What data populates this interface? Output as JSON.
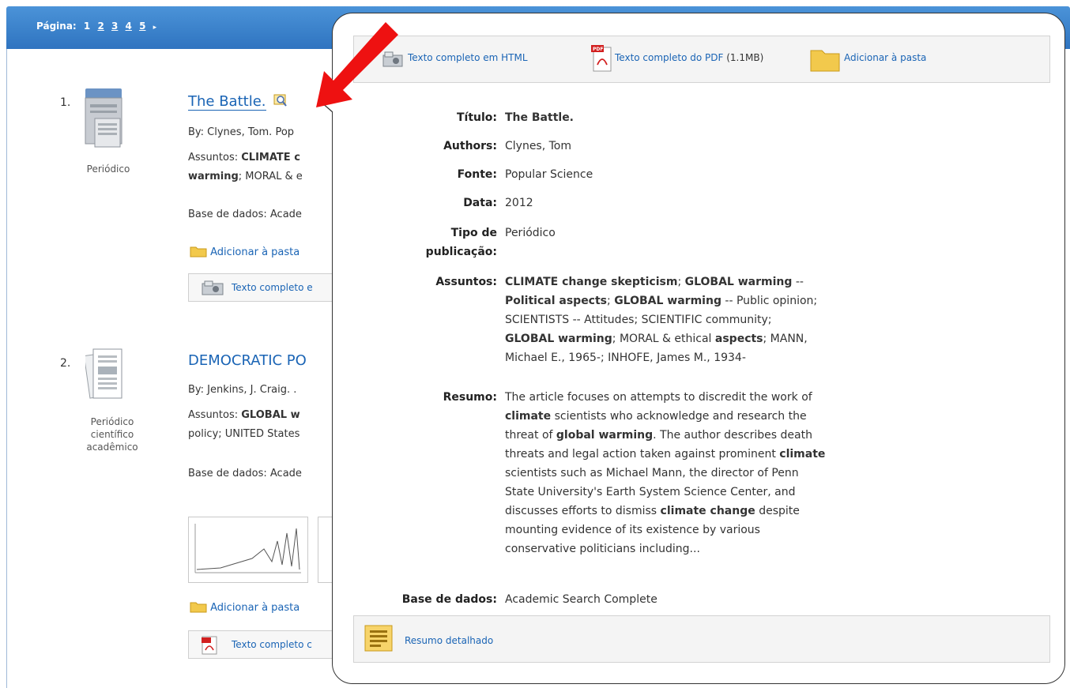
{
  "pager": {
    "label": "Página:",
    "pages": [
      "1",
      "2",
      "3",
      "4",
      "5"
    ],
    "next": "▸"
  },
  "results": [
    {
      "number": "1.",
      "type_label": "Periódico",
      "title": "The Battle.",
      "byline": "By: Clynes, Tom. Pop",
      "subjects_prefix": "Assuntos: ",
      "subjects_bold_1": "CLIMATE c",
      "subjects_line2_bold": "warming",
      "subjects_line2_rest": "; MORAL & e",
      "database": "Base de dados: Acade",
      "add_folder": "Adicionar à pasta",
      "fulltext": "Texto completo e"
    },
    {
      "number": "2.",
      "type_label_1": "Periódico",
      "type_label_2": "científico",
      "type_label_3": "acadêmico",
      "title": "DEMOCRATIC PO",
      "byline": "By: Jenkins, J. Craig. .",
      "subjects_prefix": "Assuntos: ",
      "subjects_bold": "GLOBAL w",
      "subjects_line2": "policy; UNITED States",
      "database": "Base de dados: Acade",
      "add_folder": "Adicionar à pasta",
      "fulltext": "Texto completo c"
    }
  ],
  "popup": {
    "toolbar": {
      "html_link": "Texto completo em HTML",
      "pdf_link": "Texto completo do PDF",
      "pdf_size": " (1.1MB)",
      "folder_link": "Adicionar à pasta"
    },
    "fields": {
      "titulo_label": "Título:",
      "titulo_value": "The Battle.",
      "authors_label": "Authors:",
      "authors_value": "Clynes, Tom",
      "fonte_label": "Fonte:",
      "fonte_value": "Popular Science",
      "data_label": "Data:",
      "data_value": "2012",
      "tipo_label_1": "Tipo de",
      "tipo_label_2": "publicação:",
      "tipo_value": "Periódico",
      "assuntos_label": "Assuntos:",
      "resumo_label": "Resumo:",
      "base_label": "Base de dados:",
      "base_value": "Academic Search Complete"
    },
    "assuntos": {
      "l1_a": "CLIMATE change skepticism",
      "l1_b": "; ",
      "l1_c": "GLOBAL warming",
      "l1_d": " --",
      "l2_a": "Political aspects",
      "l2_b": "; ",
      "l2_c": "GLOBAL warming",
      "l2_d": " -- Public opinion;",
      "l3": "SCIENTISTS -- Attitudes; SCIENTIFIC community;",
      "l4_a": "GLOBAL warming",
      "l4_b": "; MORAL & ethical ",
      "l4_c": "aspects",
      "l4_d": "; MANN,",
      "l5": "Michael E., 1965-; INHOFE, James M., 1934-"
    },
    "resumo": {
      "l1": "The article focuses on attempts to discredit the work of",
      "l2_b": "climate",
      "l2_r": " scientists who acknowledge and research the",
      "l3_a": "threat of ",
      "l3_b": "global warming",
      "l3_c": ". The author describes death",
      "l4_a": "threats and legal action taken against prominent ",
      "l4_b": "climate",
      "l5": "scientists such as Michael Mann, the director of Penn",
      "l6": "State University's Earth System Science Center, and",
      "l7_a": "discusses efforts to dismiss ",
      "l7_b": "climate change",
      "l7_c": " despite",
      "l8": "mounting evidence of its existence by various",
      "l9": "conservative politicians including..."
    },
    "footer_link": "Resumo detalhado"
  },
  "colors": {
    "topbar": "#3a82cc",
    "link": "#1a64b5",
    "arrow": "#ee1111"
  }
}
